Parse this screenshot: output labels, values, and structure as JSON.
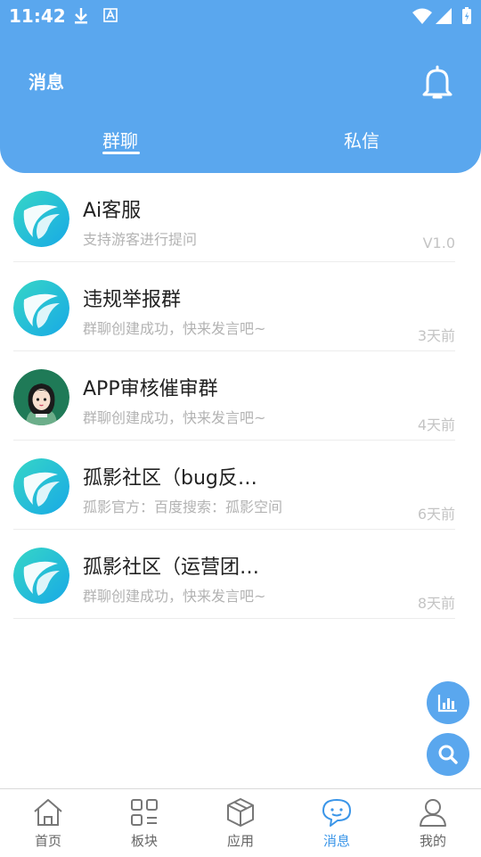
{
  "status_bar": {
    "time": "11:42"
  },
  "header": {
    "title": "消息",
    "tabs": [
      {
        "label": "群聊",
        "active": true
      },
      {
        "label": "私信",
        "active": false
      }
    ]
  },
  "conversations": [
    {
      "name": "Ai客服",
      "preview": "支持游客进行提问",
      "time": "V1.0",
      "avatar": "app-logo"
    },
    {
      "name": "违规举报群",
      "preview": "群聊创建成功，快来发言吧~",
      "time": "3天前",
      "avatar": "app-logo"
    },
    {
      "name": "APP审核催审群",
      "preview": "群聊创建成功，快来发言吧~",
      "time": "4天前",
      "avatar": "girl-portrait"
    },
    {
      "name": "孤影社区（bug反…",
      "preview": "孤影官方：百度搜索：孤影空间",
      "time": "6天前",
      "avatar": "app-logo"
    },
    {
      "name": "孤影社区（运营团…",
      "preview": "群聊创建成功，快来发言吧~",
      "time": "8天前",
      "avatar": "app-logo"
    }
  ],
  "bottom_nav": [
    {
      "label": "首页",
      "icon": "home-icon"
    },
    {
      "label": "板块",
      "icon": "grid-icon"
    },
    {
      "label": "应用",
      "icon": "box-icon"
    },
    {
      "label": "消息",
      "icon": "chat-icon",
      "active": true
    },
    {
      "label": "我的",
      "icon": "profile-icon"
    }
  ],
  "colors": {
    "primary": "#5aa7ee",
    "active_tab": "#3a95e8"
  }
}
